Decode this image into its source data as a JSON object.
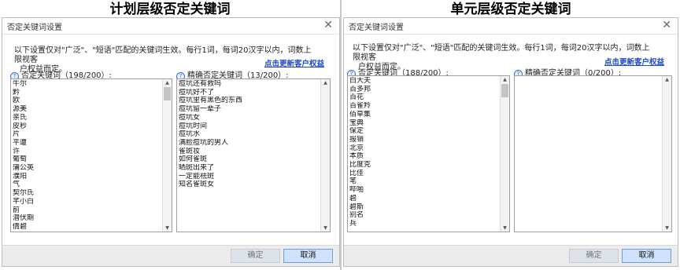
{
  "left": {
    "heading": "计划层级否定关键词",
    "dialog_title": "否定关键词设置",
    "description_line1": "以下设置仅对\"广泛\"、\"短语\"匹配的关键词生效。每行1词，每词20汉字以内，词数上限视客",
    "description_line2": "户权益而定。",
    "upgrade_link": "点击更新客户权益",
    "neg_label": "否定关键词（198/200）:",
    "exact_label": "精确否定关键词（13/200）:",
    "neg_keywords": [
      "牛尔",
      "黔",
      "欧",
      "源美",
      "亲氏",
      "皮秒",
      "片",
      "平遭",
      "许",
      "葡萄",
      "蒲公英",
      "濮阳",
      "气",
      "契尔氏",
      "芊小白",
      "前",
      "潜伏期",
      "倩碧"
    ],
    "exact_keywords": [
      "痘坑还有救吗",
      "痘坑好不了",
      "痘坑里有黑色的东西",
      "痘坑留一辈子",
      "痘坑女",
      "痘坑时间",
      "痘坑水",
      "满脸痘坑的男人",
      "雀斑妆",
      "如何雀斑",
      "晒斑出来了",
      "一定能祛斑",
      "知名雀斑女"
    ],
    "ok_label": "确定",
    "cancel_label": "取消"
  },
  "right": {
    "heading": "单元层级否定关键词",
    "dialog_title": "否定关键词设置",
    "description_line1": "以下设置仅对\"广泛\"、\"短语\"匹配的关键词生效。每行1词，每词20汉字以内，词数上限视客",
    "description_line2": "户权益而定。",
    "upgrade_link": "点击更新客户权益",
    "neg_label": "否定关键词（188/200）:",
    "exact_label": "精确否定关键词（0/200）:",
    "neg_keywords": [
      "白大夫",
      "百多邦",
      "百花",
      "百雀羚",
      "佰草集",
      "宝典",
      "保定",
      "报销",
      "北京",
      "本质",
      "比度克",
      "比佳",
      "笔",
      "哔啪",
      "碧",
      "碧斯",
      "别名",
      "兵"
    ],
    "exact_keywords": [],
    "ok_label": "确定",
    "cancel_label": "取消"
  },
  "colors": {
    "link": "#1d48c8",
    "cancel_button_bg": "#cfe1fb",
    "ok_button_bg": "#dde3ea",
    "footer_bg": "#ececec"
  },
  "icons": {
    "close": "close-icon",
    "help": "question-icon",
    "scroll_up": "arrow-up-icon",
    "scroll_down": "arrow-down-icon"
  }
}
